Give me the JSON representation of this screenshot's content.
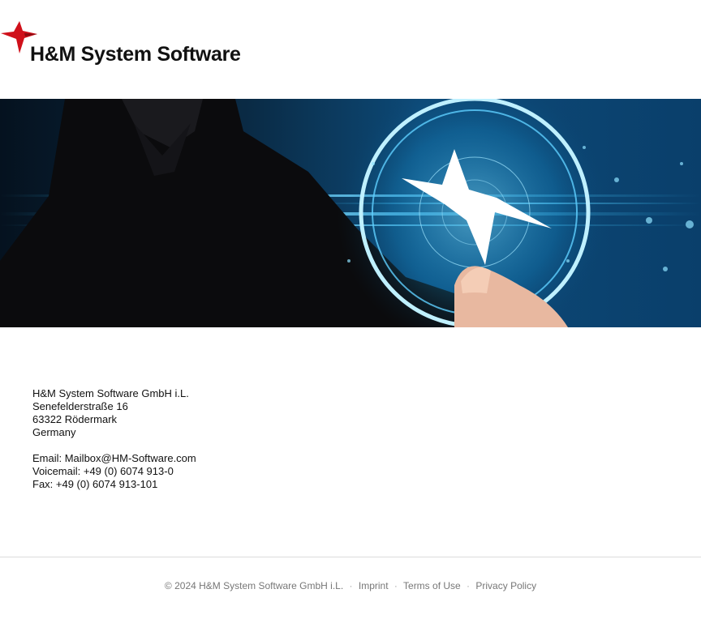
{
  "header": {
    "logo_text": "H&M System Software"
  },
  "banner": {
    "description_icon": "hummingbird-touch-hero"
  },
  "address": {
    "company": "H&M System Software GmbH i.L.",
    "street": "Senefelderstraße 16",
    "city": "63322 Rödermark",
    "country": "Germany",
    "email": "Email: Mailbox@HM-Software.com",
    "voicemail": "Voicemail: +49 (0) 6074 913-0",
    "fax": "Fax: +49 (0) 6074 913-101"
  },
  "footer": {
    "copyright": "© 2024 H&M System Software GmbH i.L.",
    "separator": "·",
    "links": [
      "Imprint",
      "Terms of Use",
      "Privacy Policy"
    ]
  },
  "colors": {
    "brand_red": "#d0101a",
    "glow_blue": "#2fb8f0",
    "footer_text": "#777777"
  }
}
